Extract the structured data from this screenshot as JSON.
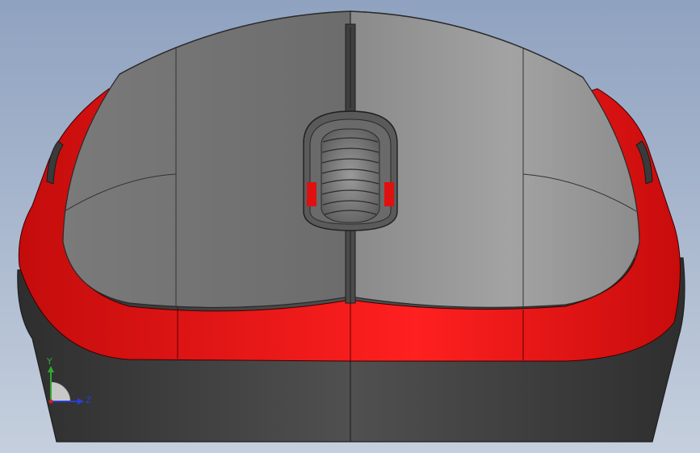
{
  "viewport": {
    "background_top": "#8fa2c0",
    "background_bottom": "#c5cfdd"
  },
  "model": {
    "body_color": "#808080",
    "accent_color": "#e01010",
    "base_color": "#4a4a4a"
  },
  "triad": {
    "y_label": "Y",
    "z_label": "Z",
    "y_color": "#2eaa2e",
    "z_color": "#2a3fd0",
    "x_color": "#d02020"
  }
}
